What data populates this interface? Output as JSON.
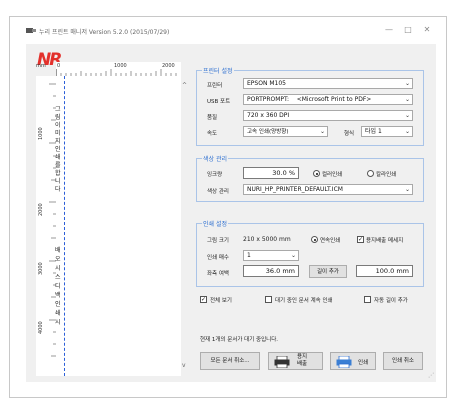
{
  "window": {
    "title": "누리 프린트 매니저 Version 5.2.0 (2015/07/29)",
    "minimize": "—",
    "maximize": "□",
    "close": "✕"
  },
  "logo": "NR",
  "ruler": {
    "unit": "mm",
    "h_ticks": [
      "0",
      "1000",
      "2000"
    ],
    "v_ticks": [
      "1000",
      "2000",
      "3000",
      "4000"
    ]
  },
  "preview": {
    "text_top": "그림이미지인쇄를합니다",
    "text_bottom": "배오시스디백인쇄시"
  },
  "printer_settings": {
    "title": "프린터 설정",
    "printer_label": "프린터",
    "printer_value": "EPSON M105",
    "usb_label": "USB 포트",
    "usb_value": "PORTPROMPT:    <Microsoft Print to PDF>",
    "quality_label": "품질",
    "quality_value": "720 x 360 DPI",
    "speed_label": "속도",
    "speed_value": "고속 인쇄(양방향)",
    "type_label": "형식",
    "type_value": "타입 1"
  },
  "color_management": {
    "title": "색상 관리",
    "ink_label": "잉크량",
    "ink_value": "30.0 %",
    "mono_label": "컬러인쇄",
    "color_label": "칼라인쇄",
    "profile_label": "색상 관리",
    "profile_value": "NURI_HP_PRINTER_DEFAULT.ICM"
  },
  "print_settings": {
    "title": "인쇄 설정",
    "size_label": "그림 크기",
    "size_value": "210 x 5000 mm",
    "continuous_label": "연속인쇄",
    "borderless_label": "용지배출 메세지",
    "copies_label": "인쇄 매수",
    "copies_value": "1",
    "margin_label": "좌측 여백",
    "margin_value": "36.0 mm",
    "add_length_button": "길이 추가",
    "length_value": "100.0 mm"
  },
  "options": {
    "full_view": "전체 보기",
    "wait_print": "대기 중인 문서 계속 인쇄",
    "auto_length": "자동 길이 추가"
  },
  "status": "현재 1개의 문서가 대기 중입니다.",
  "buttons": {
    "cancel_docs": "모든 문서 취소...",
    "eject": "용지\n배출",
    "print": "인쇄",
    "cancel_print": "인쇄 취소"
  },
  "colors": {
    "accent": "#2d6fd0",
    "logo": "#e3302b",
    "group_border": "#aac4e8"
  }
}
